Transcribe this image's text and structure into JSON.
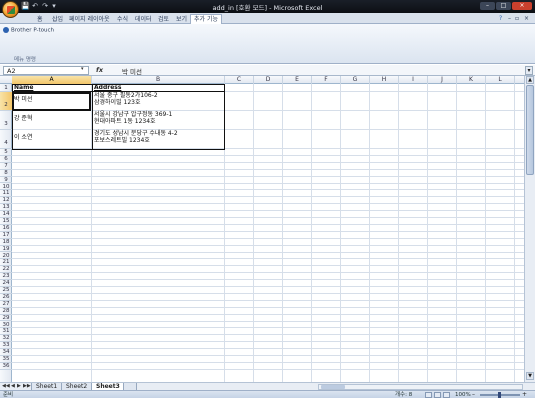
{
  "window": {
    "title": "add_in [호환 모드] - Microsoft Excel",
    "controls": {
      "minimize": "–",
      "maximize": "□",
      "close": "×"
    }
  },
  "quick_access": {
    "save": "💾",
    "undo": "↶",
    "redo": "↷",
    "customize": "▾"
  },
  "ribbon": {
    "tabs": [
      "홈",
      "삽입",
      "페이지 레이아웃",
      "수식",
      "데이터",
      "검토",
      "보기",
      "추가 기능"
    ],
    "active_tab": "추가 기능",
    "right_icons": {
      "help": "?",
      "min": "–",
      "restore": "▫",
      "close": "×"
    },
    "group_item": "Brother P-touch",
    "group_label": "메뉴 명령"
  },
  "formula_bar": {
    "name_box": "A2",
    "name_box_arrow": "▾",
    "fx": "fx",
    "value": "박 미선",
    "expand": "▾"
  },
  "columns": [
    "A",
    "B",
    "C",
    "D",
    "E",
    "F",
    "G",
    "H",
    "I",
    "J",
    "K",
    "L"
  ],
  "selected_column": "A",
  "selected_rows": [
    "2"
  ],
  "rows": [
    "1",
    "2",
    "3",
    "4",
    "5",
    "6",
    "7",
    "8",
    "9",
    "10",
    "11",
    "12",
    "13",
    "14",
    "15",
    "16",
    "17",
    "18",
    "19",
    "20",
    "21",
    "22",
    "23",
    "24",
    "25",
    "26",
    "27",
    "28",
    "29",
    "30",
    "31",
    "32",
    "33",
    "34",
    "35",
    "36"
  ],
  "table": {
    "headers": {
      "a": "Name",
      "b": "Address"
    },
    "records": [
      {
        "name": "박 미선",
        "addr1": "서울 중구 필동2가106-2",
        "addr2": "삼경하이빌 123호"
      },
      {
        "name": "강 준혁",
        "addr1": "서울시 강남구 압구정동 369-1",
        "addr2": "현대아파트 1동 1234호"
      },
      {
        "name": "이 소연",
        "addr1": "경기도 성남시 분당구 수내동 4-2",
        "addr2": "포보스레트빌 1234호"
      }
    ]
  },
  "sheet_tabs": [
    "Sheet1",
    "Sheet2",
    "Sheet3"
  ],
  "active_sheet": "Sheet3",
  "sheet_nav": [
    "◀◀",
    "◀",
    "▶",
    "▶▶"
  ],
  "status": {
    "ready": "준비",
    "count": "개수: 8",
    "zoom": "100%",
    "zoom_minus": "–",
    "zoom_plus": "+"
  },
  "scroll": {
    "up": "▲",
    "down": "▼"
  },
  "colors": {
    "title_bar": "#101419",
    "ribbon": "#dbe4f0",
    "selection": "#f3c66a"
  }
}
